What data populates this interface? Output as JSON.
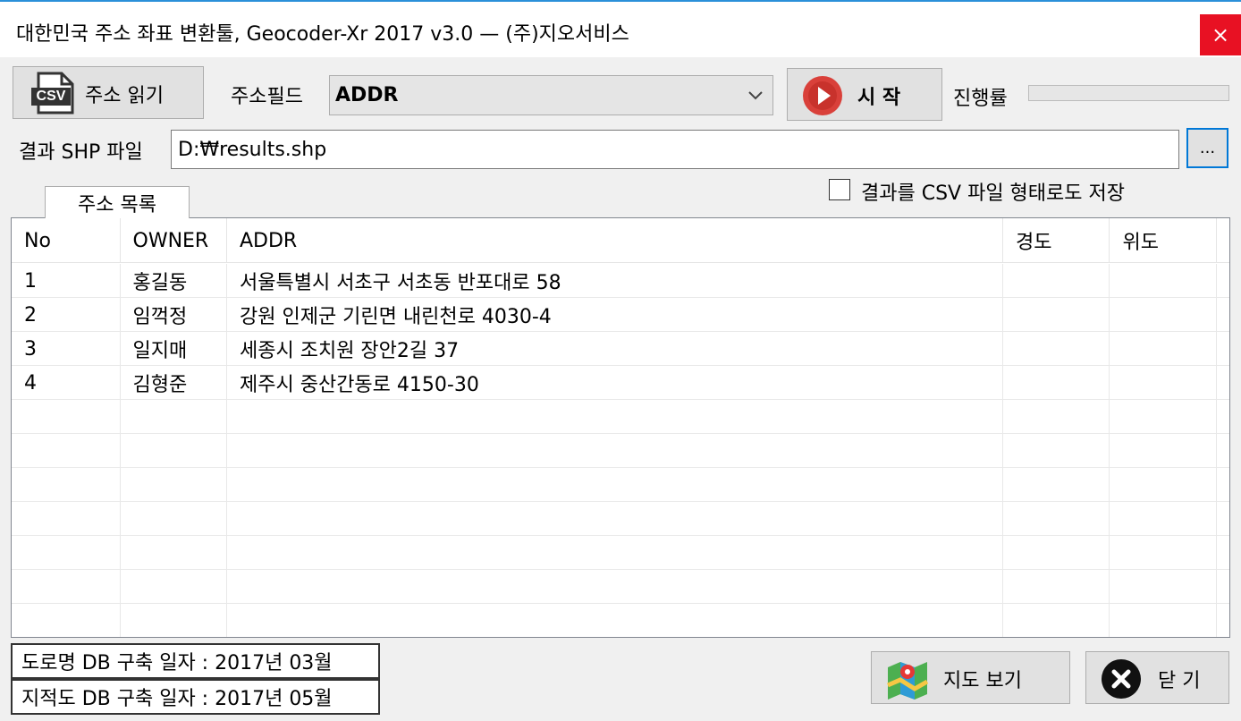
{
  "window": {
    "title": "대한민국 주소 좌표 변환툴, Geocoder-Xr 2017 v3.0 — (주)지오서비스",
    "close_glyph": "×"
  },
  "toolbar": {
    "read_address_label": "주소 읽기",
    "csv_icon_text": "CSV",
    "address_field_label": "주소필드",
    "address_field_value": "ADDR",
    "start_label": "시 작",
    "progress_label": "진행률",
    "progress_value": 0
  },
  "output": {
    "label": "결과 SHP 파일",
    "path": "D:₩results.shp",
    "browse_label": "...",
    "save_csv_label": "결과를 CSV 파일 형태로도 저장",
    "save_csv_checked": false
  },
  "tab": {
    "label": "주소 목록"
  },
  "table": {
    "columns": [
      "No",
      "OWNER",
      "ADDR",
      "경도",
      "위도"
    ],
    "rows": [
      [
        "1",
        "홍길동",
        "서울특별시 서초구 서초동 반포대로 58",
        "",
        ""
      ],
      [
        "2",
        "임꺽정",
        "강원 인제군 기린면 내린천로 4030-4",
        "",
        ""
      ],
      [
        "3",
        "일지매",
        "세종시 조치원 장안2길 37",
        "",
        ""
      ],
      [
        "4",
        "김형준",
        "제주시 중산간동로 4150-30",
        "",
        ""
      ]
    ]
  },
  "footer": {
    "road_db_date": "도로명 DB 구축 일자 : 2017년 03월",
    "cadastral_db_date": "지적도 DB 구축 일자 : 2017년 05월",
    "map_view_label": "지도 보기",
    "close_label": "닫 기"
  },
  "colors": {
    "accent": "#0078d7",
    "start_icon": "#d9403a",
    "close_window": "#e81123"
  }
}
